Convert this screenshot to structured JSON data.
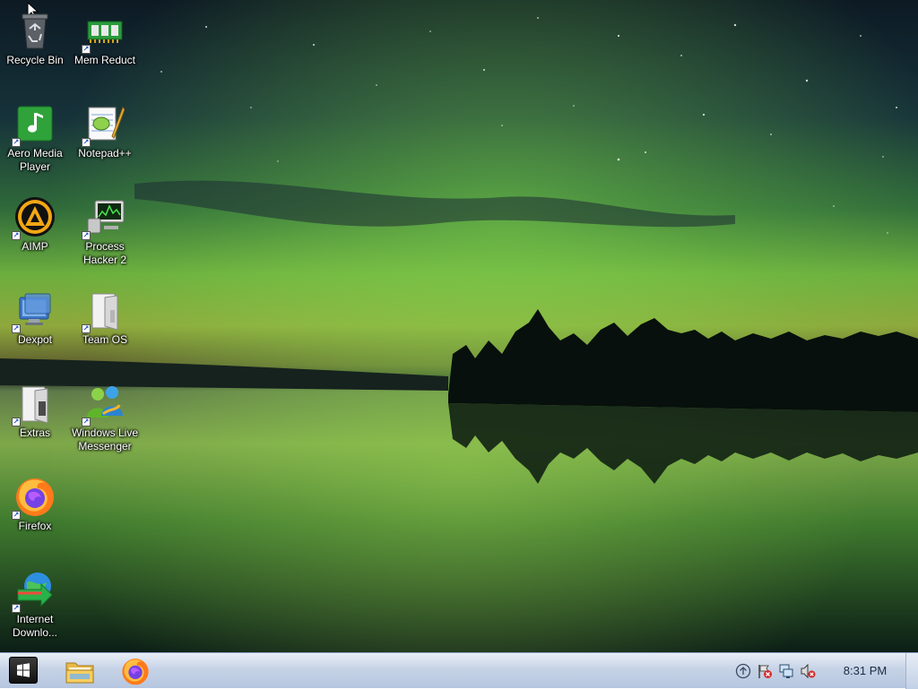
{
  "desktop": {
    "wallpaper": "northern-lights-over-lake",
    "icons": [
      {
        "label": "Recycle Bin",
        "icon": "recycle-bin-icon"
      },
      {
        "label": "Mem Reduct",
        "icon": "memory-chip-icon"
      },
      {
        "label": "Aero Media Player",
        "icon": "music-note-icon"
      },
      {
        "label": "Notepad++",
        "icon": "notepad-plus-plus-icon"
      },
      {
        "label": "AIMP",
        "icon": "aimp-icon"
      },
      {
        "label": "Process Hacker 2",
        "icon": "process-hacker-icon"
      },
      {
        "label": "Dexpot",
        "icon": "dexpot-icon"
      },
      {
        "label": "Team OS",
        "icon": "folder-icon"
      },
      {
        "label": "Extras",
        "icon": "folder-icon"
      },
      {
        "label": "Windows Live Messenger",
        "icon": "messenger-icon"
      },
      {
        "label": "Firefox",
        "icon": "firefox-icon"
      },
      {
        "label": "Internet Downlo...",
        "icon": "internet-download-manager-icon"
      }
    ]
  },
  "taskbar": {
    "start_icon": "windows-logo-icon",
    "pinned": [
      {
        "name": "File Explorer",
        "icon": "file-explorer-icon"
      },
      {
        "name": "Firefox",
        "icon": "firefox-icon"
      }
    ],
    "tray": [
      "show-hidden-icons-icon",
      "action-center-flag-icon",
      "network-icon",
      "volume-muted-icon"
    ],
    "clock": "8:31 PM"
  },
  "colors": {
    "taskbar_top": "#e9eef6",
    "taskbar_bottom": "#b5c6df",
    "aurora_green": "#5fbf3a",
    "sky": "#0e1f2a"
  }
}
